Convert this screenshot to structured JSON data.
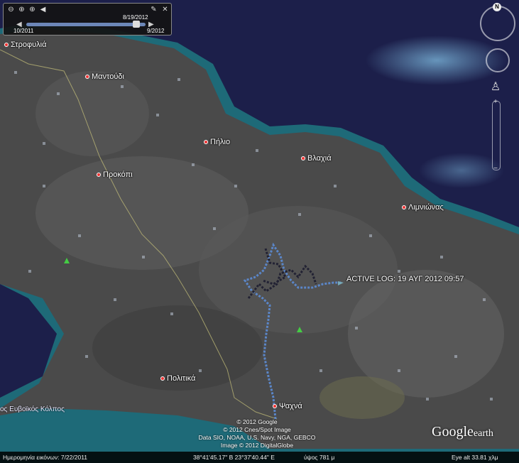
{
  "places": [
    {
      "id": "strofylia",
      "label": "Στροφυλιά"
    },
    {
      "id": "mantoudi",
      "label": "Μαντούδι"
    },
    {
      "id": "pilio",
      "label": "Πήλιο"
    },
    {
      "id": "vlachia",
      "label": "Βλαχιά"
    },
    {
      "id": "prokopi",
      "label": "Προκόπι"
    },
    {
      "id": "limnionas",
      "label": "Λιμνιώνας"
    },
    {
      "id": "politika",
      "label": "Πολιτικά"
    },
    {
      "id": "psachna",
      "label": "Ψαχνά"
    }
  ],
  "gulf_label": "ος Ευβοϊκός Κόλπος",
  "active_log": "ACTIVE LOG: 19 ΑΥΓ 2012 09:57",
  "time_slider": {
    "current": "8/19/2012",
    "start": "10/2011",
    "end": "9/2012",
    "position": 0.92
  },
  "compass": {
    "north": "N"
  },
  "credits": [
    "© 2012 Google",
    "© 2012 Cnes/Spot Image",
    "Data SIO, NOAA, U.S. Navy, NGA, GEBCO",
    "Image © 2012 DigitalGlobe"
  ],
  "logo": {
    "google": "Google",
    "earth": "earth"
  },
  "status": {
    "imagery_date": "Ημερομηνία εικόνων: 7/22/2011",
    "coords": "38°41'45.17\" B  23°37'40.44\" E",
    "elev": "ύψος 781 μ",
    "eye_alt": "Eye alt   33.81 χλμ"
  },
  "colors": {
    "sea": "#1c1f4a",
    "land": "#4c4c4c",
    "shallow": "#1e6a78",
    "track": "#5b86c8",
    "place_dot": "#e33333"
  }
}
